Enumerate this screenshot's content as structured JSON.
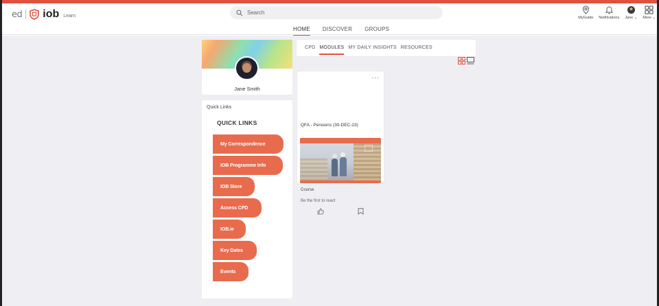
{
  "brand": {
    "ed": "ed",
    "iob": "iob",
    "learn": "Learn",
    "accent": "#e0513f",
    "button_color": "#e86b4e"
  },
  "search": {
    "placeholder": "Search"
  },
  "nav": {
    "tabs": [
      {
        "label": "HOME",
        "active": true
      },
      {
        "label": "DISCOVER"
      },
      {
        "label": "GROUPS"
      }
    ]
  },
  "header_right": {
    "myguide": "MyGuide",
    "notifications": "Notifications",
    "user": "Jane ⌄",
    "more": "More ⌄"
  },
  "profile": {
    "name": "Jane Smith"
  },
  "quick_links": {
    "small_label": "Quick Links",
    "title": "QUICK LINKS",
    "items": [
      {
        "label": "My Correspondence"
      },
      {
        "label": "IOB Programme Info"
      },
      {
        "label": "IOB Store"
      },
      {
        "label": "Access CPD"
      },
      {
        "label": "IOB.ie"
      },
      {
        "label": "Key Dates"
      },
      {
        "label": "Events"
      }
    ]
  },
  "content_tabs": [
    {
      "label": "CPD"
    },
    {
      "label": "MODULES",
      "active": true
    },
    {
      "label": "MY DAILY INSIGHTS"
    },
    {
      "label": "RESOURCES"
    }
  ],
  "module": {
    "menu": "···",
    "title": "QFA - Pensions (30-DEC-23)",
    "type": "Course",
    "react_text": "Be the first to react"
  },
  "icons": [
    "search-icon",
    "myguide-icon",
    "bell-icon",
    "avatar-icon",
    "grid-icon",
    "shield-icon",
    "grid-view-icon",
    "list-view-icon",
    "like-icon",
    "bookmark-icon"
  ]
}
